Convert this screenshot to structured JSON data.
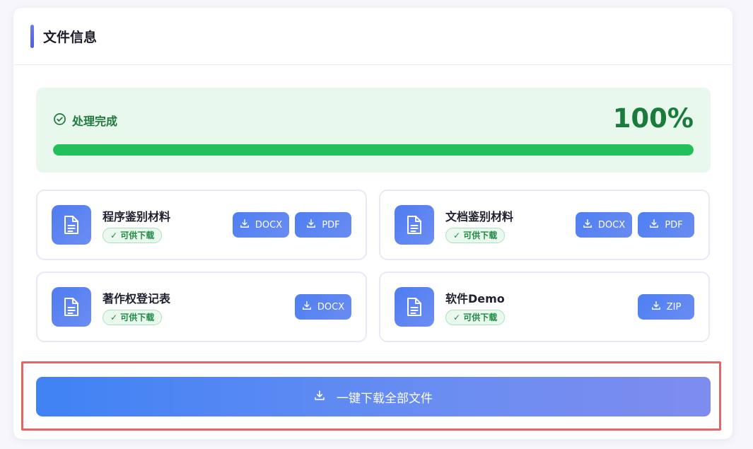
{
  "card": {
    "title": "文件信息"
  },
  "status": {
    "text": "处理完成",
    "percent_text": "100%",
    "progress": 1.0
  },
  "files": [
    {
      "name": "程序鉴别材料",
      "badge": "✓ 可供下载",
      "buttons": [
        {
          "label": "DOCX"
        },
        {
          "label": "PDF"
        }
      ]
    },
    {
      "name": "文档鉴别材料",
      "badge": "✓ 可供下载",
      "buttons": [
        {
          "label": "DOCX"
        },
        {
          "label": "PDF"
        }
      ]
    },
    {
      "name": "著作权登记表",
      "badge": "✓ 可供下载",
      "buttons": [
        {
          "label": "DOCX"
        }
      ]
    },
    {
      "name": "软件Demo",
      "badge": "✓ 可供下载",
      "buttons": [
        {
          "label": "ZIP"
        }
      ]
    }
  ],
  "download_all": {
    "label": "一键下载全部文件"
  },
  "colors": {
    "accent": "#4e5fd9",
    "success": "#22c05a",
    "button": "#4e7ff2",
    "highlight": "#e46565"
  },
  "icons": {
    "status": "check-circle-icon",
    "file": "document-icon",
    "download": "download-icon"
  }
}
